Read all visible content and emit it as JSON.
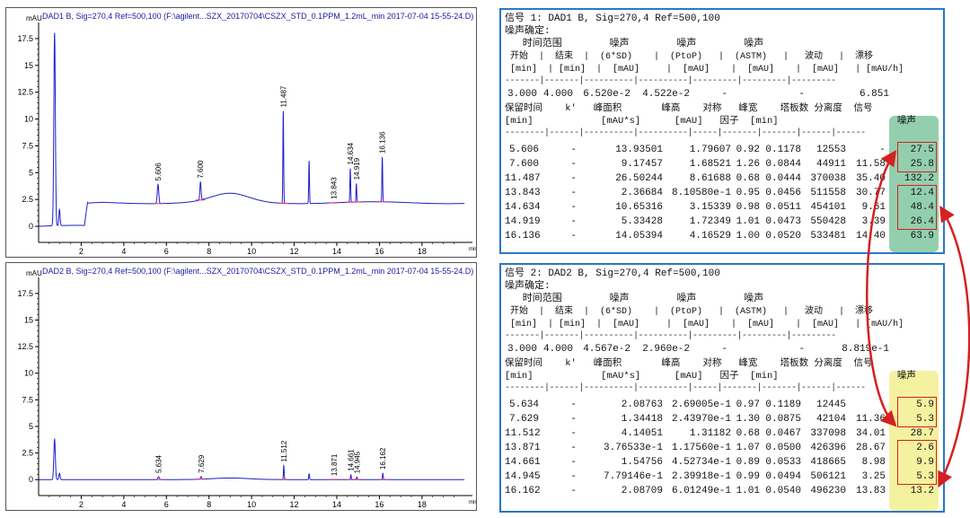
{
  "chart_data": [
    {
      "type": "line",
      "title": "DAD1 B, Sig=270,4 Ref=500,100 (F:\\agilent...SZX_20170704\\CSZX_STD_0.1PPM_1.2mL_min 2017-07-04 15-55-24.D)",
      "ylabel": "mAU",
      "xlabel": "min",
      "xlim": [
        0,
        20.2
      ],
      "ylim": [
        -1.5,
        18.5
      ],
      "xticks": [
        2,
        4,
        6,
        8,
        10,
        12,
        14,
        16,
        18
      ],
      "yticks": [
        0,
        2.5,
        5,
        7.5,
        10,
        12.5,
        15,
        17.5
      ],
      "ytick_labels": [
        "0",
        "2.5",
        "5",
        "7.5",
        "10",
        "12.5",
        "15",
        "17.5"
      ],
      "baseline": 2.2,
      "peaks": [
        {
          "x": 0.75,
          "height": 18.0,
          "width": 0.05,
          "label": ""
        },
        {
          "x": 0.98,
          "height": 1.5,
          "width": 0.04,
          "label": ""
        },
        {
          "x": 5.606,
          "height": 1.79607,
          "width": 0.05,
          "label": "5.606"
        },
        {
          "x": 7.6,
          "height": 1.68521,
          "width": 0.04,
          "label": "7.600"
        },
        {
          "x": 11.487,
          "height": 8.61688,
          "width": 0.025,
          "label": "11.487"
        },
        {
          "x": 12.7,
          "height": 4.0,
          "width": 0.025,
          "label": ""
        },
        {
          "x": 13.843,
          "height": 0.0081058,
          "width": 0.025,
          "label": "13.843"
        },
        {
          "x": 14.634,
          "height": 3.15339,
          "width": 0.025,
          "label": "14.634"
        },
        {
          "x": 14.919,
          "height": 1.72349,
          "width": 0.025,
          "label": "14.919"
        },
        {
          "x": 16.136,
          "height": 4.16529,
          "width": 0.025,
          "label": "16.136"
        }
      ],
      "hump": [
        {
          "x": 9.0,
          "height": 0.8,
          "width": 1.2
        }
      ]
    },
    {
      "type": "line",
      "title": "DAD2 B, Sig=270,4 Ref=500,100 (F:\\agilent...SZX_20170704\\CSZX_STD_0.1PPM_1.2mL_min 2017-07-04 15-55-24.D)",
      "ylabel": "mAU",
      "xlabel": "min",
      "xlim": [
        0,
        20.2
      ],
      "ylim": [
        -1.5,
        18.5
      ],
      "xticks": [
        2,
        4,
        6,
        8,
        10,
        12,
        14,
        16,
        18
      ],
      "yticks": [
        0,
        2.5,
        5,
        7.5,
        10,
        12.5,
        15,
        17.5
      ],
      "ytick_labels": [
        "0",
        "2.5",
        "5",
        "7.5",
        "10",
        "12.5",
        "15",
        "17.5"
      ],
      "baseline": 0.0,
      "peaks": [
        {
          "x": 0.75,
          "height": 3.8,
          "width": 0.05,
          "label": ""
        },
        {
          "x": 0.98,
          "height": 0.6,
          "width": 0.04,
          "label": ""
        },
        {
          "x": 5.634,
          "height": 0.269005,
          "width": 0.05,
          "label": "5.634"
        },
        {
          "x": 7.629,
          "height": 0.24397,
          "width": 0.04,
          "label": "7.629"
        },
        {
          "x": 11.512,
          "height": 1.31182,
          "width": 0.025,
          "label": "11.512"
        },
        {
          "x": 12.7,
          "height": 0.55,
          "width": 0.025,
          "label": ""
        },
        {
          "x": 13.871,
          "height": 0.011756,
          "width": 0.025,
          "label": "13.871"
        },
        {
          "x": 14.661,
          "height": 0.452734,
          "width": 0.025,
          "label": "14.661"
        },
        {
          "x": 14.945,
          "height": 0.239918,
          "width": 0.025,
          "label": "14.945"
        },
        {
          "x": 16.162,
          "height": 0.601249,
          "width": 0.025,
          "label": "16.162"
        }
      ],
      "hump": [
        {
          "x": 9.0,
          "height": 0.15,
          "width": 1.2
        }
      ]
    }
  ],
  "reports": [
    {
      "header": "信号 1: DAD1 B, Sig=270,4 Ref=500,100",
      "noise_title": "噪声确定:",
      "noise_hdr1": "   时间范围        噪声        噪声        噪声",
      "noise_hdr2": " 开始  |  结束  |  (6*SD)    |  (PtoP)   |  (ASTM)   |   波动   |  漂移",
      "noise_hdr3": " [min]  | [min]  |  [mAU]     |  [mAU]    |  [mAU]    |  [mAU]   | [mAU/h]",
      "noise_dash": "-------|-------|----------|----------|---------|---------|---------",
      "noise_row": {
        "start": "3.000",
        "end": "4.000",
        "sd": "6.520e-2",
        "ptop": "4.522e-2",
        "astm": "-",
        "wander": "-",
        "drift": "6.851"
      },
      "peak_hdr1": "保留时间    k'   峰面积       峰高    对称   峰宽    塔板数 分离度  信号",
      "peak_hdr2": "[min]            [mAU*s]      [mAU]   因子  [min]                     噪声",
      "peak_dash": "--------|------|----------|----------|-----|-------|-------|------|------",
      "rows": [
        {
          "rt": "5.606",
          "k": "-",
          "area": "13.93501",
          "height": "1.79607",
          "sym": "0.92",
          "width": "0.1178",
          "plates": "12553",
          "res": "-",
          "sn": "27.5"
        },
        {
          "rt": "7.600",
          "k": "-",
          "area": "9.17457",
          "height": "1.68521",
          "sym": "1.26",
          "width": "0.0844",
          "plates": "44911",
          "res": "11.58",
          "sn": "25.8"
        },
        {
          "rt": "11.487",
          "k": "-",
          "area": "26.50244",
          "height": "8.61688",
          "sym": "0.68",
          "width": "0.0444",
          "plates": "370038",
          "res": "35.40",
          "sn": "132.2"
        },
        {
          "rt": "13.843",
          "k": "-",
          "area": "2.36684",
          "height": "8.10580e-1",
          "sym": "0.95",
          "width": "0.0456",
          "plates": "511558",
          "res": "30.77",
          "sn": "12.4"
        },
        {
          "rt": "14.634",
          "k": "-",
          "area": "10.65316",
          "height": "3.15339",
          "sym": "0.98",
          "width": "0.0511",
          "plates": "454101",
          "res": "9.61",
          "sn": "48.4"
        },
        {
          "rt": "14.919",
          "k": "-",
          "area": "5.33428",
          "height": "1.72349",
          "sym": "1.01",
          "width": "0.0473",
          "plates": "550428",
          "res": "3.39",
          "sn": "26.4"
        },
        {
          "rt": "16.136",
          "k": "-",
          "area": "14.05394",
          "height": "4.16529",
          "sym": "1.00",
          "width": "0.0520",
          "plates": "533481",
          "res": "14.40",
          "sn": "63.9"
        }
      ]
    },
    {
      "header": "信号 2: DAD2 B, Sig=270,4 Ref=500,100",
      "noise_title": "噪声确定:",
      "noise_hdr1": "   时间范围        噪声        噪声        噪声",
      "noise_hdr2": " 开始  |  结束  |  (6*SD)    |  (PtoP)   |  (ASTM)   |   波动   |  漂移",
      "noise_hdr3": " [min]  | [min]  |  [mAU]     |  [mAU]    |  [mAU]    |  [mAU]   | [mAU/h]",
      "noise_dash": "-------|-------|----------|----------|---------|---------|---------",
      "noise_row": {
        "start": "3.000",
        "end": "4.000",
        "sd": "4.567e-2",
        "ptop": "2.960e-2",
        "astm": "-",
        "wander": "-",
        "drift": "8.819e-1"
      },
      "peak_hdr1": "保留时间    k'   峰面积       峰高    对称   峰宽    塔板数 分离度  信号",
      "peak_hdr2": "[min]            [mAU*s]      [mAU]   因子  [min]                     噪声",
      "peak_dash": "--------|------|----------|----------|-----|-------|-------|------|------",
      "rows": [
        {
          "rt": "5.634",
          "k": "-",
          "area": "2.08763",
          "height": "2.69005e-1",
          "sym": "0.97",
          "width": "0.1189",
          "plates": "12445",
          "res": "-",
          "sn": "5.9"
        },
        {
          "rt": "7.629",
          "k": "-",
          "area": "1.34418",
          "height": "2.43970e-1",
          "sym": "1.30",
          "width": "0.0875",
          "plates": "42104",
          "res": "11.36",
          "sn": "5.3"
        },
        {
          "rt": "11.512",
          "k": "-",
          "area": "4.14051",
          "height": "1.31182",
          "sym": "0.68",
          "width": "0.0467",
          "plates": "337098",
          "res": "34.01",
          "sn": "28.7"
        },
        {
          "rt": "13.871",
          "k": "-",
          "area": "3.76533e-1",
          "height": "1.17560e-1",
          "sym": "1.07",
          "width": "0.0500",
          "plates": "426396",
          "res": "28.67",
          "sn": "2.6"
        },
        {
          "rt": "14.661",
          "k": "-",
          "area": "1.54756",
          "height": "4.52734e-1",
          "sym": "0.89",
          "width": "0.0533",
          "plates": "418665",
          "res": "8.98",
          "sn": "9.9"
        },
        {
          "rt": "14.945",
          "k": "-",
          "area": "7.79146e-1",
          "height": "2.39918e-1",
          "sym": "0.99",
          "width": "0.0494",
          "plates": "506121",
          "res": "3.25",
          "sn": "5.3"
        },
        {
          "rt": "16.162",
          "k": "-",
          "area": "2.08709",
          "height": "6.01249e-1",
          "sym": "1.01",
          "width": "0.0540",
          "plates": "496230",
          "res": "13.83",
          "sn": "13.2"
        }
      ]
    }
  ],
  "colors": {
    "trace": "#1f1fcc",
    "integration": "#e0306a",
    "report_border": "#2b77c6",
    "highlight1": "#93cfae",
    "highlight2": "#f4f2a0",
    "annotation": "#d42020"
  }
}
